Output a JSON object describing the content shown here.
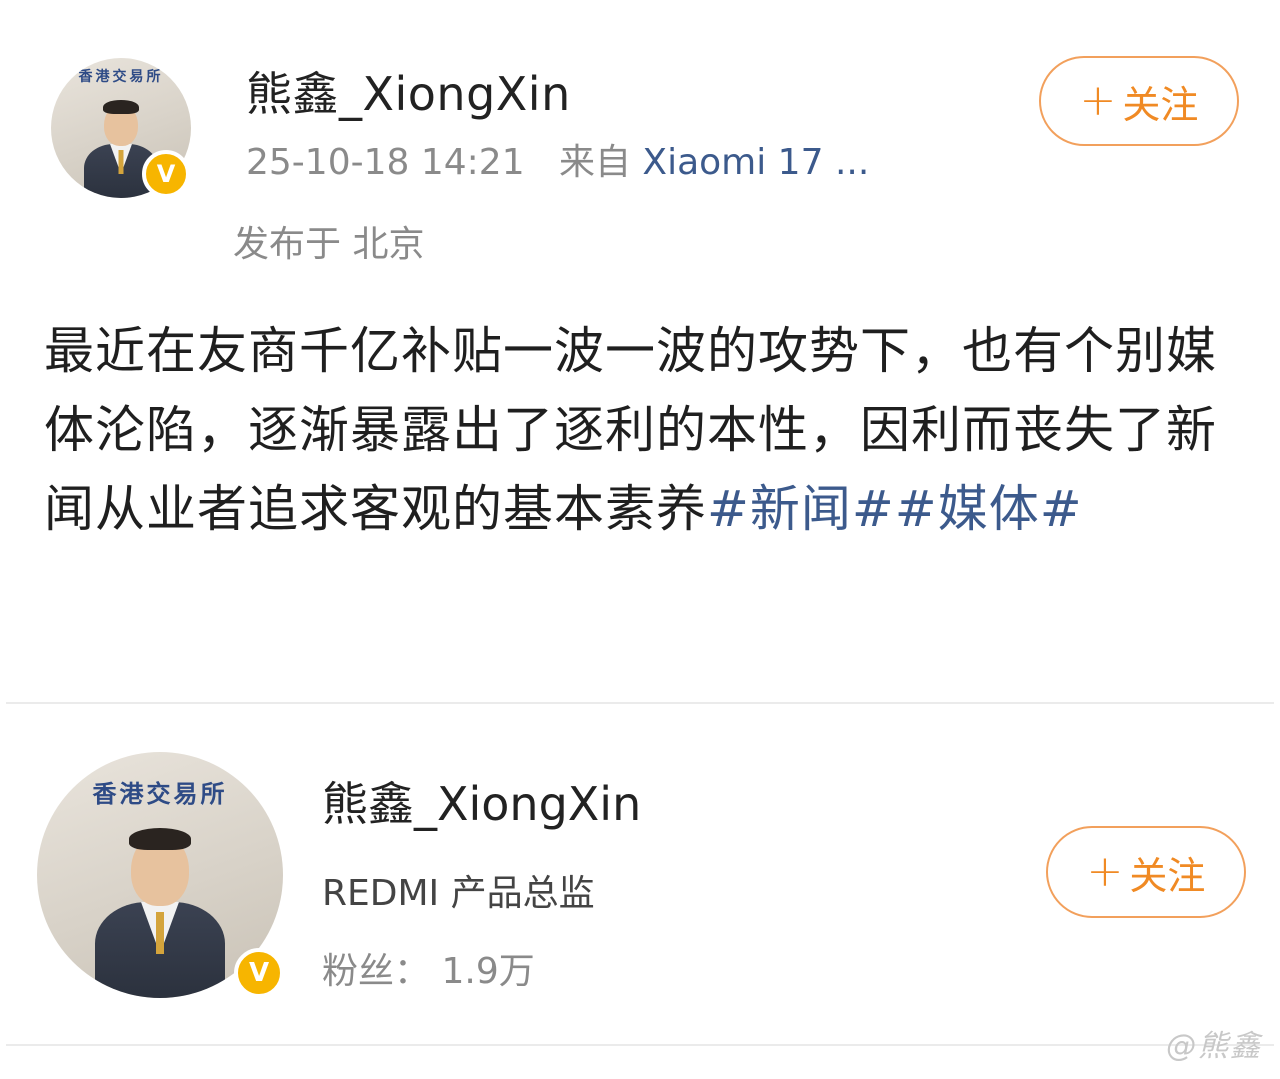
{
  "post": {
    "author": "熊鑫_XiongXin",
    "time": "25-10-18 14:21",
    "source_prefix": "来自",
    "device": "Xiaomi 17 ...",
    "location": "发布于 北京",
    "follow_label": "关注",
    "body": "最近在友商千亿补贴一波一波的攻势下，也有个别媒体沦陷，逐渐暴露出了逐利的本性，因利而丧失了新闻从业者追求客观的基本素养",
    "tags": [
      "#新闻#",
      "#媒体#"
    ]
  },
  "profile": {
    "name": "熊鑫_XiongXin",
    "title": "REDMI 产品总监",
    "fans_label": "粉丝：",
    "fans_count": "1.9万",
    "follow_label": "关注"
  },
  "avatar": {
    "wall_text": "香港交易所",
    "verified_badge": "V"
  },
  "watermark": "@熊鑫",
  "colors": {
    "accent_orange": "#f08a24",
    "link_blue": "#3c5a8c",
    "verified_yellow": "#f7b500"
  }
}
